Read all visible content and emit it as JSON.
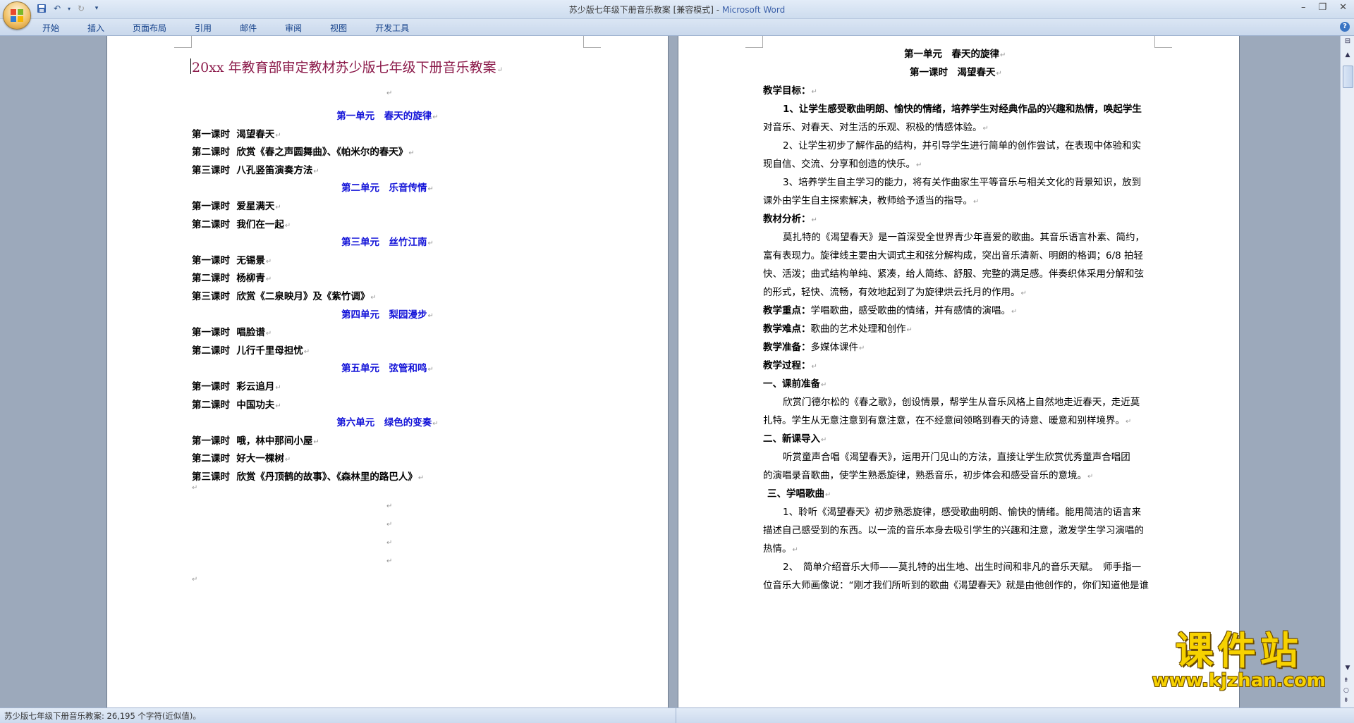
{
  "window": {
    "doc_name": "苏少版七年级下册音乐教案",
    "mode": "[兼容模式]",
    "separator": "-",
    "app_name": "Microsoft Word"
  },
  "ribbon": {
    "tabs": [
      "开始",
      "插入",
      "页面布局",
      "引用",
      "邮件",
      "审阅",
      "视图",
      "开发工具"
    ]
  },
  "left_page": {
    "title": "20xx 年教育部审定教材苏少版七年级下册音乐教案",
    "units": [
      {
        "name": "第一单元　春天的旋律",
        "lessons": [
          {
            "label": "第一课时",
            "name": "渴望春天"
          },
          {
            "label": "第二课时",
            "name": "欣赏《春之声圆舞曲》、《帕米尔的春天》"
          },
          {
            "label": "第三课时",
            "name": "八孔竖笛演奏方法"
          }
        ]
      },
      {
        "name": "第二单元　乐音传情",
        "lessons": [
          {
            "label": "第一课时",
            "name": "爱星满天"
          },
          {
            "label": "第二课时",
            "name": "我们在一起"
          }
        ]
      },
      {
        "name": "第三单元　丝竹江南",
        "lessons": [
          {
            "label": "第一课时",
            "name": "无锡景"
          },
          {
            "label": "第二课时",
            "name": "杨柳青"
          },
          {
            "label": "第三课时",
            "name": "欣赏《二泉映月》及《紫竹调》"
          }
        ]
      },
      {
        "name": "第四单元　梨园漫步",
        "lessons": [
          {
            "label": "第一课时",
            "name": "唱脸谱"
          },
          {
            "label": "第二课时",
            "name": "儿行千里母担忧"
          }
        ]
      },
      {
        "name": "第五单元　弦管和鸣",
        "lessons": [
          {
            "label": "第一课时",
            "name": "彩云追月"
          },
          {
            "label": "第二课时",
            "name": "中国功夫"
          }
        ]
      },
      {
        "name": "第六单元　绿色的变奏",
        "lessons": [
          {
            "label": "第一课时",
            "name": "哦，林中那间小屋"
          },
          {
            "label": "第二课时",
            "name": "好大一棵树"
          },
          {
            "label": "第三课时",
            "name": "欣赏《丹顶鹤的故事》、《森林里的路巴人》"
          }
        ]
      }
    ]
  },
  "right_page": {
    "unit_title": "第一单元　春天的旋律",
    "lesson_title": "第一课时　渴望春天",
    "objectives_label": "教学目标：",
    "objective_1a": "1、让学生感受歌曲明朗、愉快的情绪，培养学生对经典作品的兴趣和热情，唤起学生",
    "objective_1b": "对音乐、对春天、对生活的乐观、积极的情感体验。",
    "objective_2a": "2、让学生初步了解作品的结构，并引导学生进行简单的创作尝试，在表现中体验和实",
    "objective_2b": "现自信、交流、分享和创造的快乐。",
    "objective_3a": "3、培养学生自主学习的能力，将有关作曲家生平等音乐与相关文化的背景知识，放到",
    "objective_3b": "课外由学生自主探索解决，教师给予适当的指导。",
    "analysis_label": "教材分析：",
    "analysis_1": "莫扎特的《渴望春天》是一首深受全世界青少年喜爱的歌曲。其音乐语言朴素、简约，",
    "analysis_2": "富有表现力。旋律线主要由大调式主和弦分解构成，突出音乐清新、明朗的格调；6/8 拍轻",
    "analysis_3": "快、活泼；曲式结构单纯、紧凑，给人简练、舒服、完整的满足感。伴奏织体采用分解和弦",
    "analysis_4": "的形式，轻快、流畅，有效地起到了为旋律烘云托月的作用。",
    "key_label": "教学重点：",
    "key_text": "学唱歌曲，感受歌曲的情绪，并有感情的演唱。",
    "difficult_label": "教学难点：",
    "difficult_text": "歌曲的艺术处理和创作",
    "prep_label": "教学准备：",
    "prep_text": "多媒体课件",
    "process_label": "教学过程：",
    "step1_label": "一、课前准备",
    "step1_a": "欣赏门德尔松的《春之歌》，创设情景，帮学生从音乐风格上自然地走近春天，走近莫",
    "step1_b": "扎特。学生从无意注意到有意注意，在不经意间领略到春天的诗意、暖意和别样境界。",
    "step2_label": "二、新课导入",
    "step2_a": "听赏童声合唱《渴望春天》，运用开门见山的方法，直接让学生欣赏优秀童声合唱团",
    "step2_b": "的演唱录音歌曲，使学生熟悉旋律，熟悉音乐，初步体会和感受音乐的意境。",
    "step3_label": "三、学唱歌曲",
    "step3_1a": "1、聆听《渴望春天》初步熟悉旋律，感受歌曲明朗、愉快的情绪。能用简洁的语言来",
    "step3_1b": "描述自己感受到的东西。以一流的音乐本身去吸引学生的兴趣和注意，激发学生学习演唱的",
    "step3_1c": "热情。",
    "step3_2a": "2、　简单介绍音乐大师——莫扎特的出生地、出生时间和非凡的音乐天赋。　师手指一",
    "step3_2b": "位音乐大师画像说：“刚才我们所听到的歌曲《渴望春天》就是由他创作的，你们知道他是谁"
  },
  "status": {
    "text": "苏少版七年级下册音乐教案: 26,195 个字符(近似值)。"
  },
  "watermark": {
    "cn": "课件站",
    "url": "www.kjzhan.com"
  }
}
